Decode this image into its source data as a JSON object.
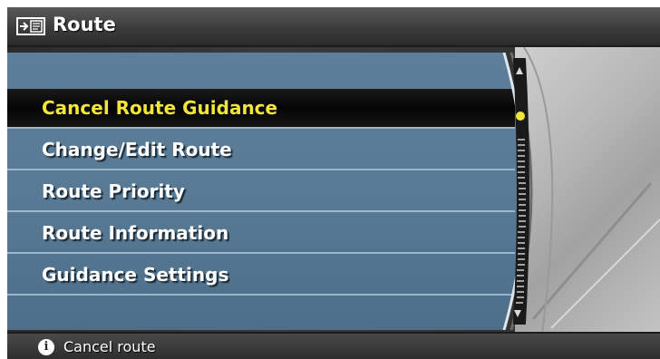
{
  "header": {
    "title": "Route",
    "icon": "route-menu-icon"
  },
  "menu": {
    "items": [
      {
        "label": "Cancel Route Guidance",
        "selected": true
      },
      {
        "label": "Change/Edit Route",
        "selected": false
      },
      {
        "label": "Route Priority",
        "selected": false
      },
      {
        "label": "Route Information",
        "selected": false
      },
      {
        "label": "Guidance Settings",
        "selected": false
      }
    ]
  },
  "status": {
    "icon": "info-icon",
    "text": "Cancel route"
  },
  "colors": {
    "selected_text": "#f3e63a",
    "menu_bg": "#587a94",
    "separator": "#9fb6c8",
    "highlight_bg": "#0a0a0a"
  }
}
